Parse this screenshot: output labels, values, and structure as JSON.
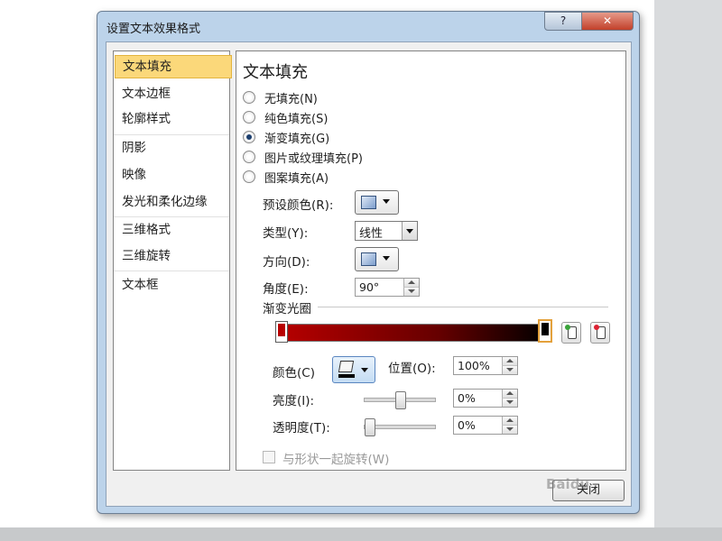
{
  "window": {
    "title": "设置文本效果格式",
    "help_label": "?",
    "close_label": "✕"
  },
  "sidebar": {
    "items": [
      {
        "label": "文本填充"
      },
      {
        "label": "文本边框"
      },
      {
        "label": "轮廓样式"
      },
      {
        "label": "阴影"
      },
      {
        "label": "映像"
      },
      {
        "label": "发光和柔化边缘"
      },
      {
        "label": "三维格式"
      },
      {
        "label": "三维旋转"
      },
      {
        "label": "文本框"
      }
    ],
    "selected": "文本填充"
  },
  "panel": {
    "title": "文本填充",
    "fill_options": [
      {
        "label": "无填充(N)",
        "checked": false
      },
      {
        "label": "纯色填充(S)",
        "checked": false
      },
      {
        "label": "渐变填充(G)",
        "checked": true
      },
      {
        "label": "图片或纹理填充(P)",
        "checked": false
      },
      {
        "label": "图案填充(A)",
        "checked": false
      }
    ],
    "preset_label": "预设颜色(R):",
    "type_label": "类型(Y):",
    "type_value": "线性",
    "direction_label": "方向(D):",
    "angle_label": "角度(E):",
    "angle_value": "90°",
    "stops_label": "渐变光圈",
    "gradient": {
      "start_color": "#b80000",
      "end_color": "#000000"
    },
    "color_label": "颜色(C)",
    "position_label": "位置(O):",
    "position_value": "100%",
    "brightness_label": "亮度(I):",
    "brightness_value": "0%",
    "brightness_level": 0.5,
    "transparency_label": "透明度(T):",
    "transparency_value": "0%",
    "transparency_level": 0.0,
    "rotate_label": "与形状一起旋转(W)"
  },
  "footer": {
    "close_label": "关闭"
  },
  "watermark": "Baidu"
}
